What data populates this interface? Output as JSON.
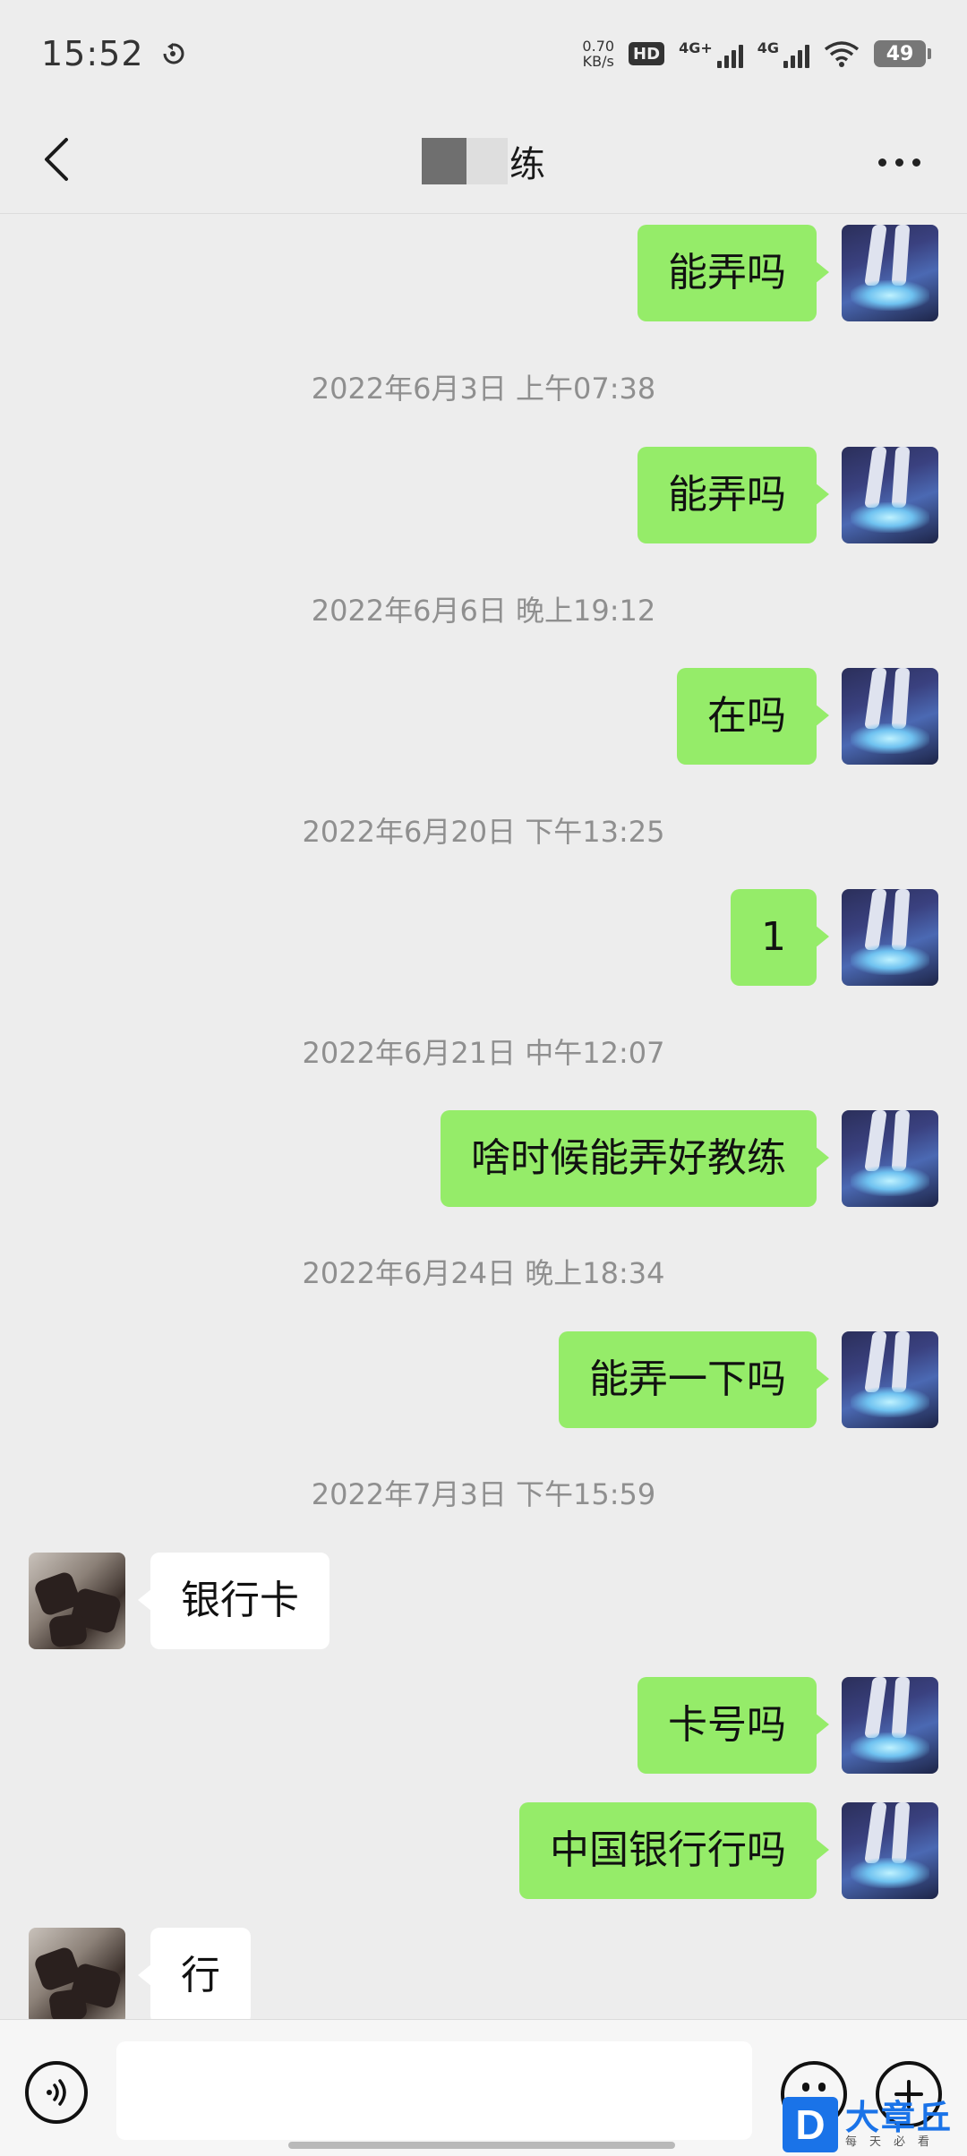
{
  "status_bar": {
    "time": "15:52",
    "net_speed_value": "0.70",
    "net_speed_unit": "KB/s",
    "hd_label": "HD",
    "sim1_label": "4G+",
    "sim2_label": "4G",
    "battery": "49"
  },
  "nav": {
    "title_visible_char": "练"
  },
  "messages": [
    {
      "type": "out",
      "text": "能弄吗"
    },
    {
      "type": "time",
      "text": "2022年6月3日 上午07:38"
    },
    {
      "type": "out",
      "text": "能弄吗"
    },
    {
      "type": "time",
      "text": "2022年6月6日 晚上19:12"
    },
    {
      "type": "out",
      "text": "在吗"
    },
    {
      "type": "time",
      "text": "2022年6月20日 下午13:25"
    },
    {
      "type": "out",
      "text": "1"
    },
    {
      "type": "time",
      "text": "2022年6月21日 中午12:07"
    },
    {
      "type": "out",
      "text": "啥时候能弄好教练"
    },
    {
      "type": "time",
      "text": "2022年6月24日 晚上18:34"
    },
    {
      "type": "out",
      "text": "能弄一下吗"
    },
    {
      "type": "time",
      "text": "2022年7月3日 下午15:59"
    },
    {
      "type": "in",
      "text": "银行卡"
    },
    {
      "type": "out",
      "text": "卡号吗"
    },
    {
      "type": "out",
      "text": "中国银行行吗"
    },
    {
      "type": "in",
      "text": "行"
    }
  ],
  "input_bar": {
    "placeholder": ""
  },
  "watermark": {
    "logo_letter": "D",
    "title": "大章丘",
    "subtitle": "每天必看"
  },
  "colors": {
    "background": "#ededed",
    "outgoing_bubble": "#95ec69",
    "incoming_bubble": "#ffffff",
    "timestamp_text": "#8f8f8f",
    "watermark_blue": "#1a73e8"
  },
  "icons": {
    "back": "chevron-left-icon",
    "more": "more-dots-icon",
    "voice": "voice-icon",
    "emoji": "emoji-icon",
    "plus": "plus-icon"
  }
}
